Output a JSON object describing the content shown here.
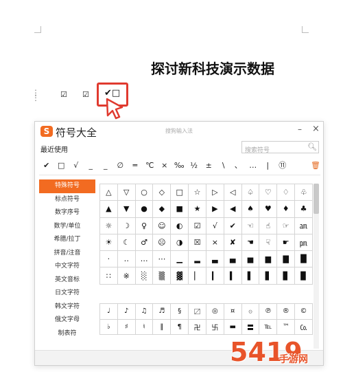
{
  "document": {
    "title": "探讨新科技演示数据",
    "inline_symbols": [
      "☑",
      "☑"
    ],
    "highlighted_text": "✔□"
  },
  "panel": {
    "logo": "S",
    "title": "符号大全",
    "ime_label": "搜狗输入法",
    "minimize": "–",
    "close": "×",
    "recent_label": "最近使用",
    "search_placeholder": "搜索符号",
    "recent_symbols": [
      "✔",
      "□",
      "√",
      "_",
      "_",
      "∅",
      "═",
      "℃",
      "×",
      "‰",
      "½",
      "±",
      "\\",
      "、",
      "…",
      "|",
      "⑪"
    ],
    "categories": [
      "特殊符号",
      "标点符号",
      "数字序号",
      "数学/单位",
      "希腊/拉丁",
      "拼音/注音",
      "中文字符",
      "英文音标",
      "日文字符",
      "韩文字符",
      "俄文字母",
      "制表符"
    ],
    "active_category": "特殊符号",
    "grid1": [
      [
        "△",
        "▽",
        "○",
        "◇",
        "□",
        "☆",
        "▷",
        "◁",
        "♤",
        "♡",
        "♢",
        "♧"
      ],
      [
        "▲",
        "▼",
        "●",
        "◆",
        "■",
        "★",
        "▶",
        "◀",
        "♠",
        "♥",
        "♦",
        "♣"
      ],
      [
        "☼",
        "☽",
        "♀",
        "☺",
        "◐",
        "☑",
        "√",
        "✔",
        "☜",
        "☝",
        "☞",
        "㏂"
      ],
      [
        "☀",
        "☾",
        "♂",
        "☹",
        "◑",
        "☒",
        "×",
        "✘",
        "☚",
        "☟",
        "☛",
        "㏘"
      ],
      [
        "·",
        "‥",
        "…",
        "⋯",
        "▁",
        "▂",
        "▃",
        "▄",
        "▅",
        "▆",
        "▇",
        "█"
      ],
      [
        "∷",
        "※",
        "░",
        "▒",
        "▓",
        "▏",
        "▎",
        "▍",
        "▌",
        "▋",
        "▊",
        "▉"
      ]
    ],
    "grid2": [
      [
        "♩",
        "♪",
        "♫",
        "♬",
        "§",
        "〼",
        "◎",
        "¤",
        "۞",
        "℗",
        "®",
        "©"
      ],
      [
        "♭",
        "♯",
        "♮",
        "‖",
        "¶",
        "卍",
        "卐",
        "▬",
        "〓",
        "℡",
        "™",
        "㏇"
      ]
    ]
  },
  "watermark": {
    "main": "5419",
    "sub": "手游网"
  }
}
